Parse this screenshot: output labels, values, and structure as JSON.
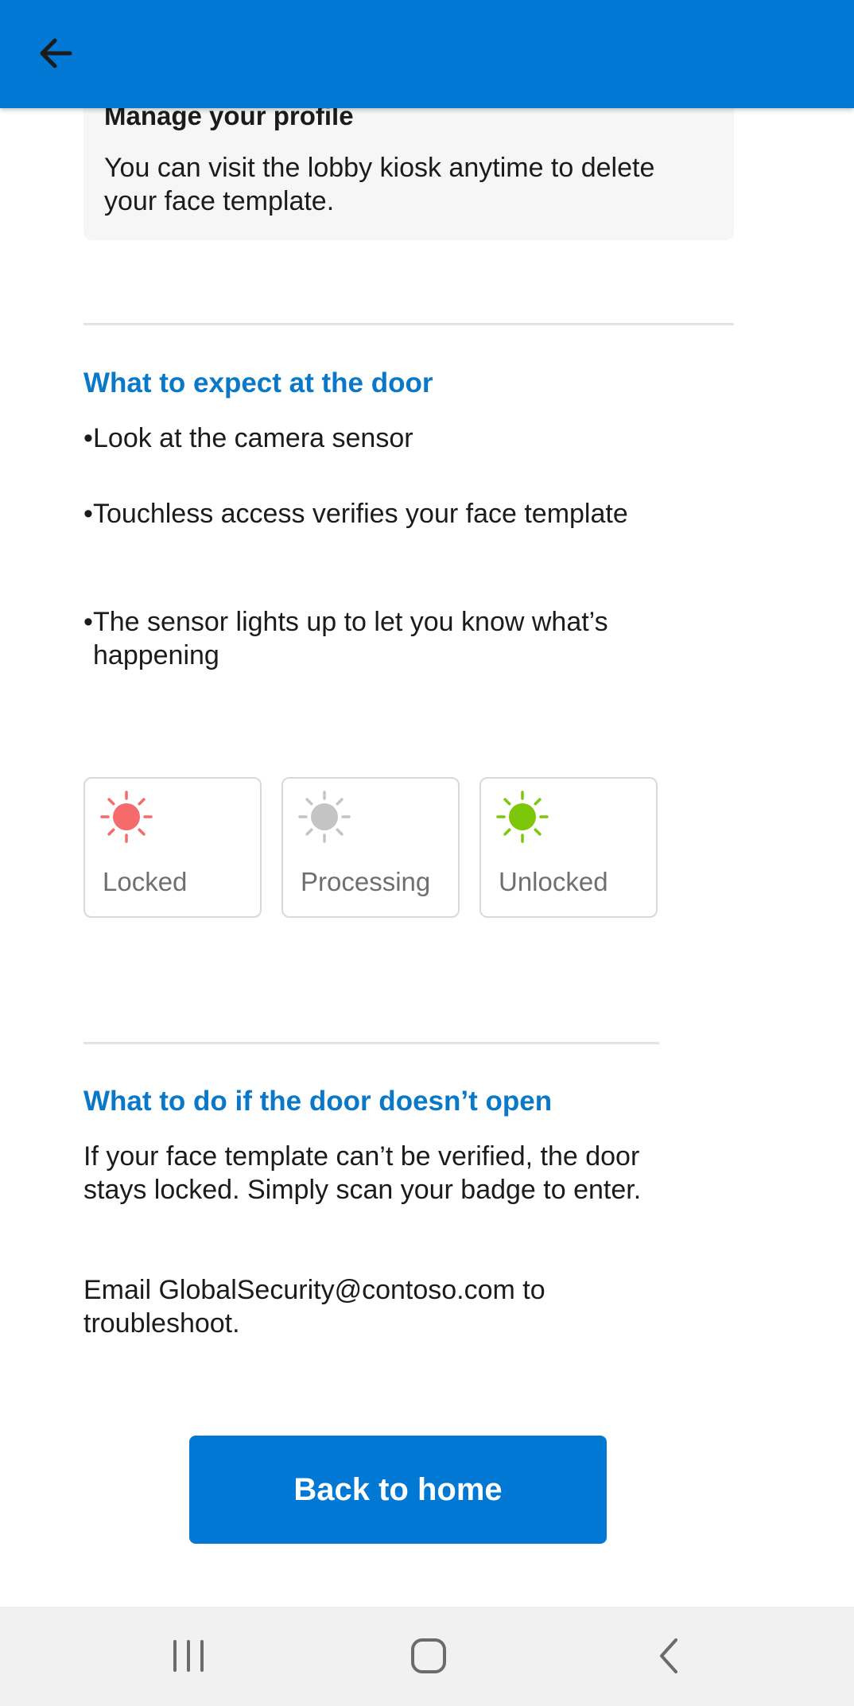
{
  "header": {
    "back_icon": "arrow-left-icon",
    "background": "#0078d4"
  },
  "profile_card": {
    "title": "Manage your profile",
    "body": "You can visit the lobby kiosk anytime to delete your face template."
  },
  "expect_section": {
    "heading": "What to expect at the door",
    "bullet_char": "•",
    "bullets": [
      "Look at the camera sensor",
      "Touchless access verifies your face template",
      "The sensor lights up to let you know what’s happening"
    ]
  },
  "status_lights": [
    {
      "label": "Locked",
      "icon": "sun-icon",
      "color": "#f56b6b"
    },
    {
      "label": "Processing",
      "icon": "sun-icon",
      "color": "#c4c4c4"
    },
    {
      "label": "Unlocked",
      "icon": "sun-icon",
      "color": "#7cc70a"
    }
  ],
  "door_section": {
    "heading": "What to do if the door doesn’t open",
    "paragraph1": "If your face template can’t be verified, the door stays locked. Simply scan your badge to enter.",
    "paragraph2": "Email GlobalSecurity@contoso.com to troubleshoot."
  },
  "actions": {
    "back_home_label": "Back to home"
  },
  "system_nav": {
    "recents_icon": "recent-apps-icon",
    "home_icon": "home-icon",
    "back_icon": "back-chevron-icon"
  },
  "colors": {
    "accent": "#0078d4",
    "heading": "#0a78c8"
  }
}
